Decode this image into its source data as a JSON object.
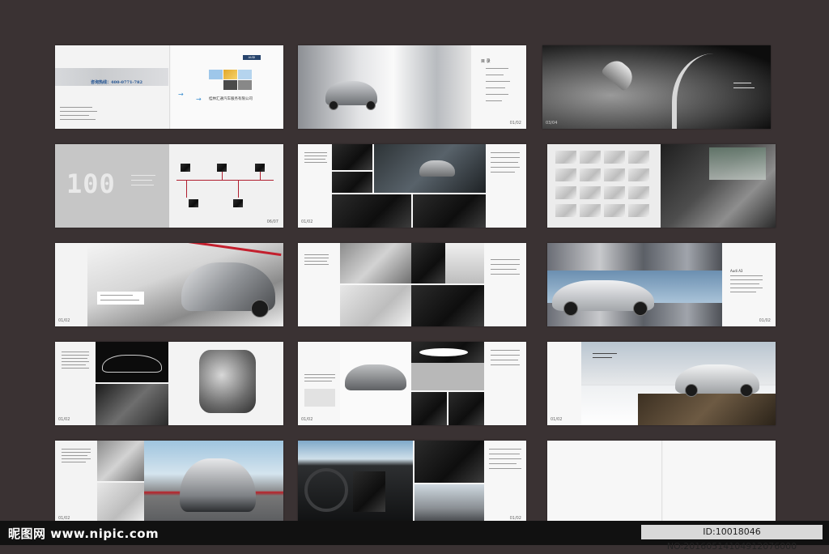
{
  "page": {
    "background": "#3a3233"
  },
  "cover": {
    "hotline": "咨询热线：400-0771-782",
    "company": "桂林汇通汽车服务有限公司",
    "tag": "AUDI"
  },
  "contents_title": "目 录",
  "page_numbers": {
    "r1c2": "01/02",
    "r1c3": "03/04",
    "r2c1": "06/07",
    "r2c2": "01/02",
    "r3c1": "01/02",
    "r3c3": "01/02",
    "r4c1": "01/02",
    "r4c2": "01/02",
    "r4c3": "01/02",
    "r5c1": "01/02",
    "r5c2": "01/02"
  },
  "timeline_number": "100",
  "model_heading": "Audi A3",
  "watermark": {
    "left": "昵图网 www.nipic.com",
    "right": "ID:10018046 NO:20160514104912076000"
  }
}
